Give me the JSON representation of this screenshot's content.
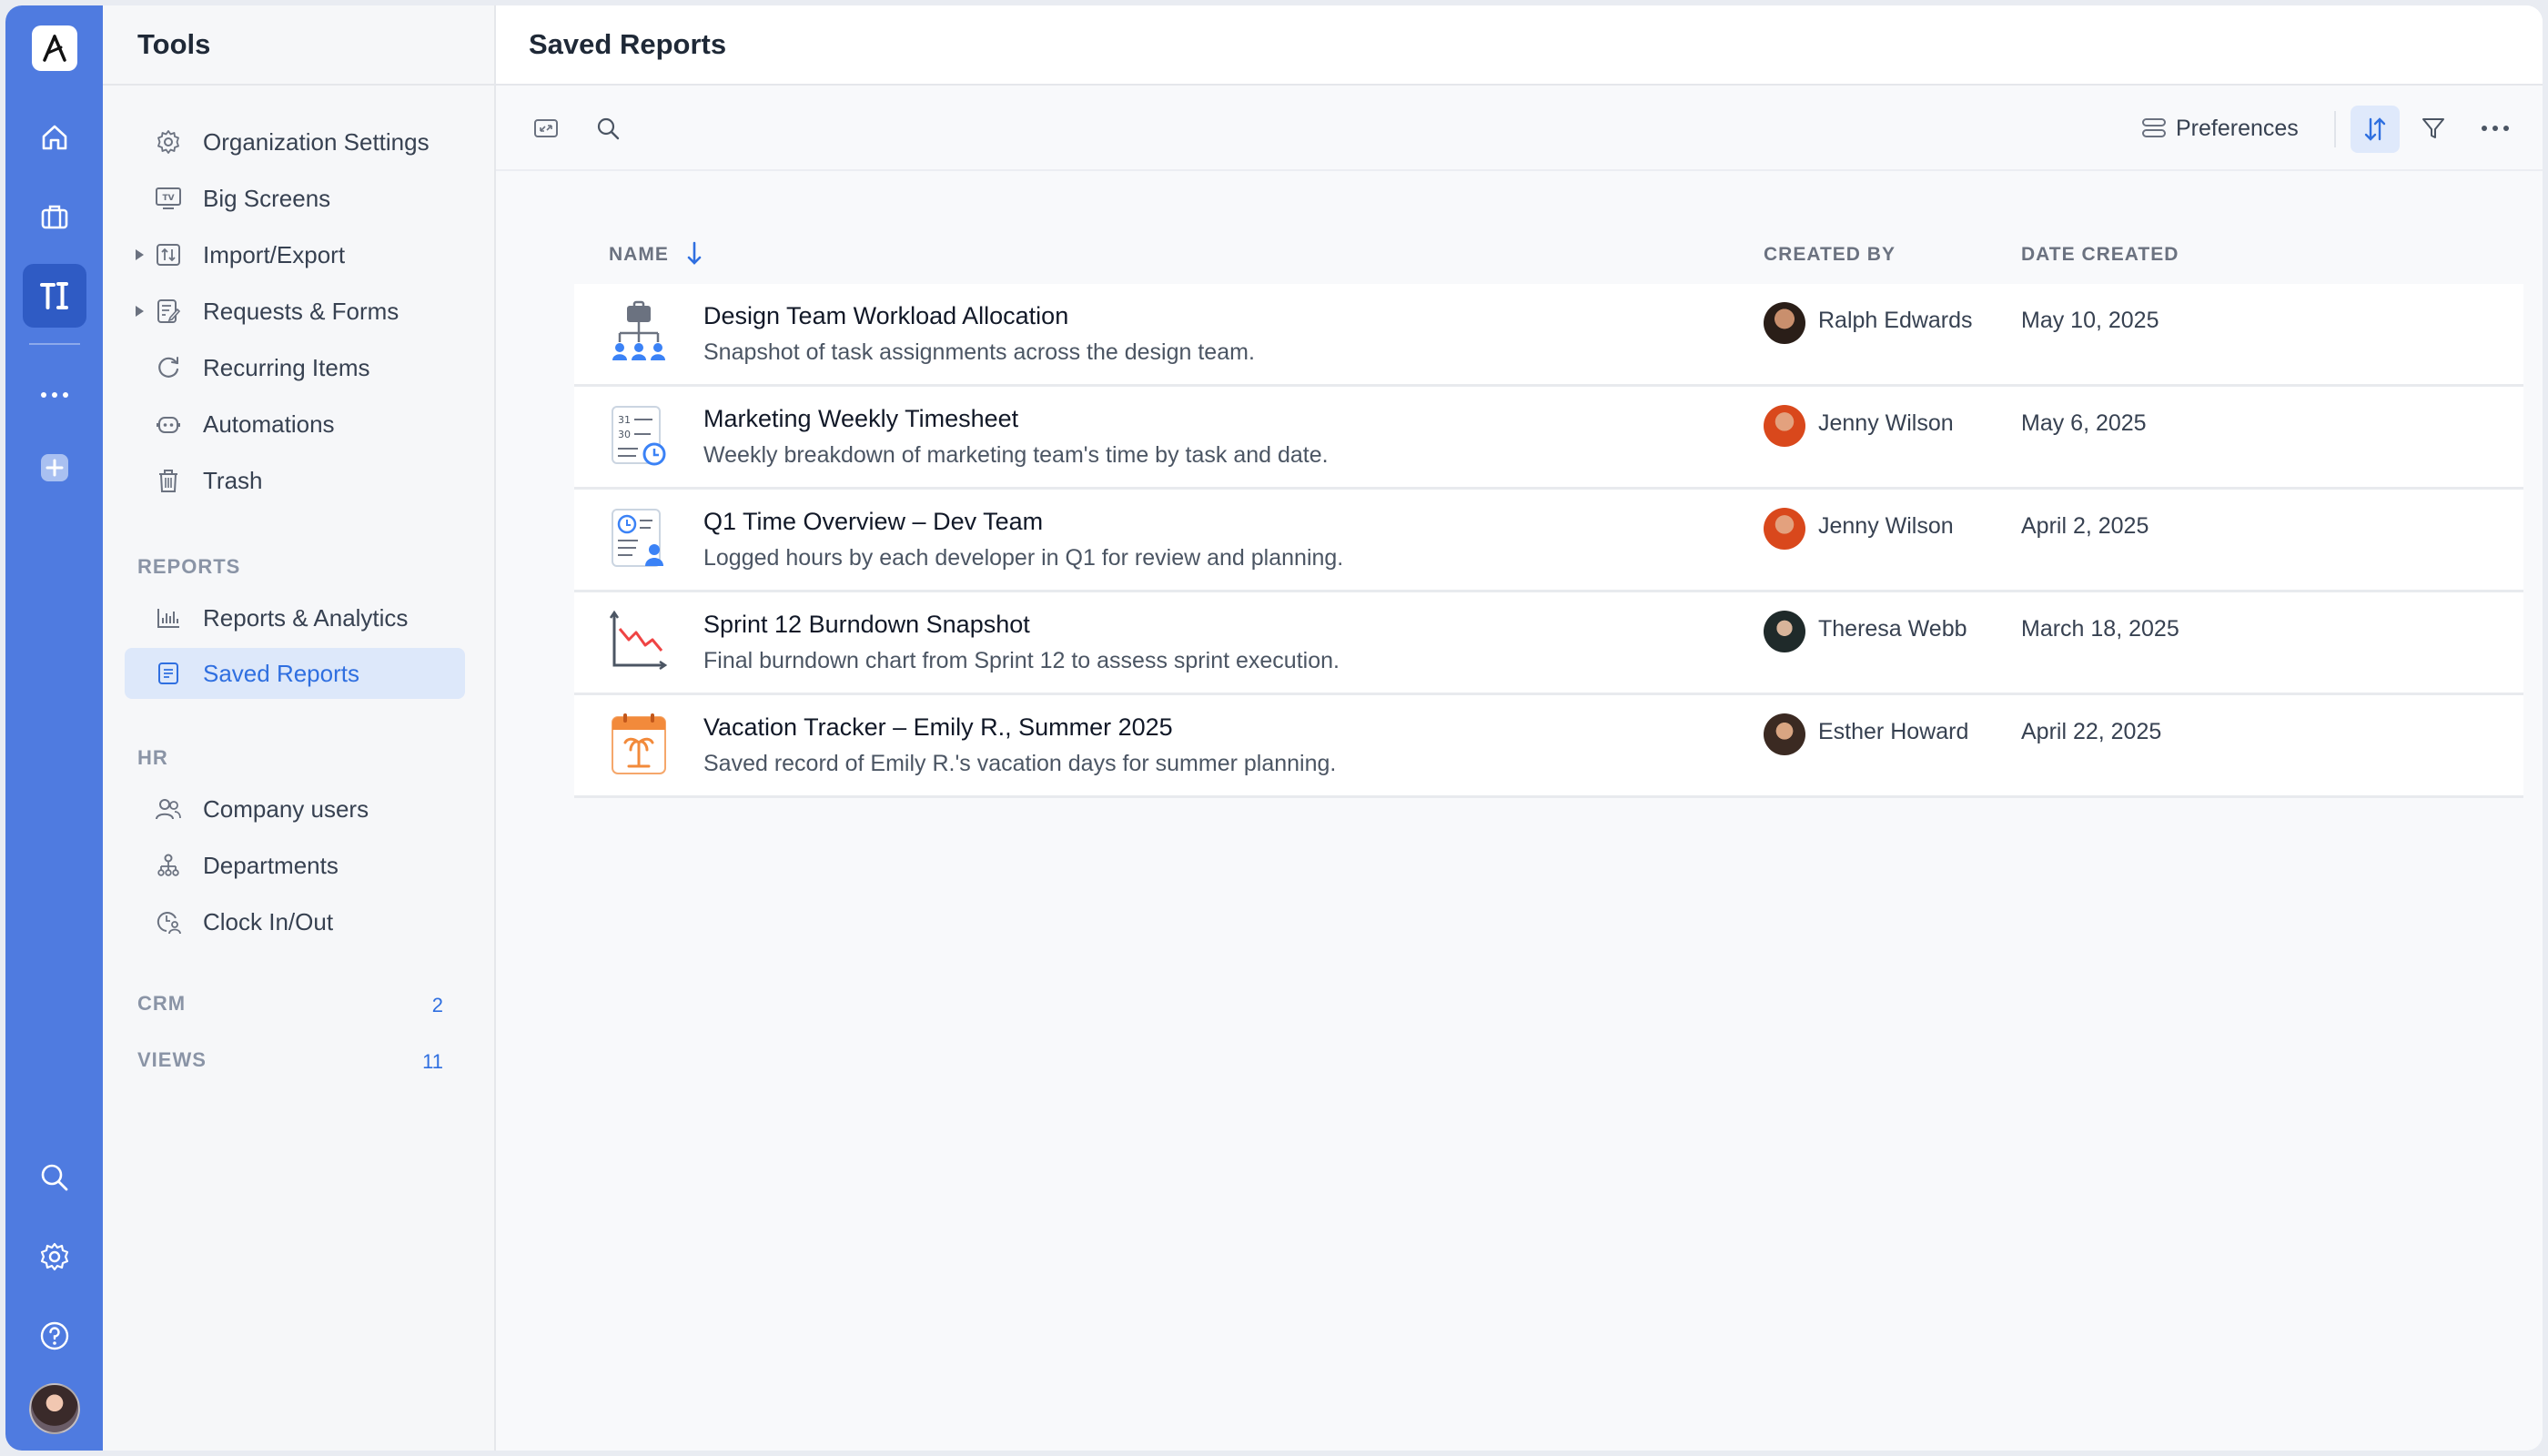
{
  "sidebar": {
    "title": "Tools",
    "items": [
      {
        "label": "Organization Settings"
      },
      {
        "label": "Big Screens"
      },
      {
        "label": "Import/Export"
      },
      {
        "label": "Requests & Forms"
      },
      {
        "label": "Recurring Items"
      },
      {
        "label": "Automations"
      },
      {
        "label": "Trash"
      }
    ],
    "reports_heading": "REPORTS",
    "reports_items": [
      {
        "label": "Reports & Analytics"
      },
      {
        "label": "Saved Reports"
      }
    ],
    "hr_heading": "HR",
    "hr_items": [
      {
        "label": "Company users"
      },
      {
        "label": "Departments"
      },
      {
        "label": "Clock In/Out"
      }
    ],
    "crm": {
      "label": "CRM",
      "count": "2"
    },
    "views": {
      "label": "VIEWS",
      "count": "11"
    }
  },
  "main": {
    "title": "Saved Reports",
    "toolbar": {
      "preferences_label": "Preferences"
    },
    "columns": {
      "name": "NAME",
      "created_by": "CREATED BY",
      "date_created": "DATE CREATED"
    },
    "rows": [
      {
        "icon": "org-chart-icon",
        "title": "Design Team Workload Allocation",
        "desc": "Snapshot of task assignments across the design team.",
        "created_by": "Ralph Edwards",
        "date": "May 10, 2025"
      },
      {
        "icon": "timesheet-icon",
        "title": "Marketing Weekly Timesheet",
        "desc": "Weekly breakdown of marketing team's time by task and date.",
        "created_by": "Jenny Wilson",
        "date": "May 6, 2025"
      },
      {
        "icon": "time-overview-icon",
        "title": "Q1 Time Overview – Dev Team",
        "desc": "Logged hours by each developer in Q1 for review and planning.",
        "created_by": "Jenny Wilson",
        "date": "April 2, 2025"
      },
      {
        "icon": "burndown-chart-icon",
        "title": "Sprint 12 Burndown Snapshot",
        "desc": "Final burndown chart from Sprint 12 to assess sprint execution.",
        "created_by": "Theresa Webb",
        "date": "March 18, 2025"
      },
      {
        "icon": "vacation-calendar-icon",
        "title": "Vacation Tracker – Emily R., Summer 2025",
        "desc": "Saved record of Emily R.'s vacation days for summer planning.",
        "created_by": "Esther Howard",
        "date": "April 22, 2025"
      }
    ]
  },
  "colors": {
    "rail": "#4f7be0",
    "accent": "#2f6fe0",
    "active_bg": "#dde8fa"
  }
}
